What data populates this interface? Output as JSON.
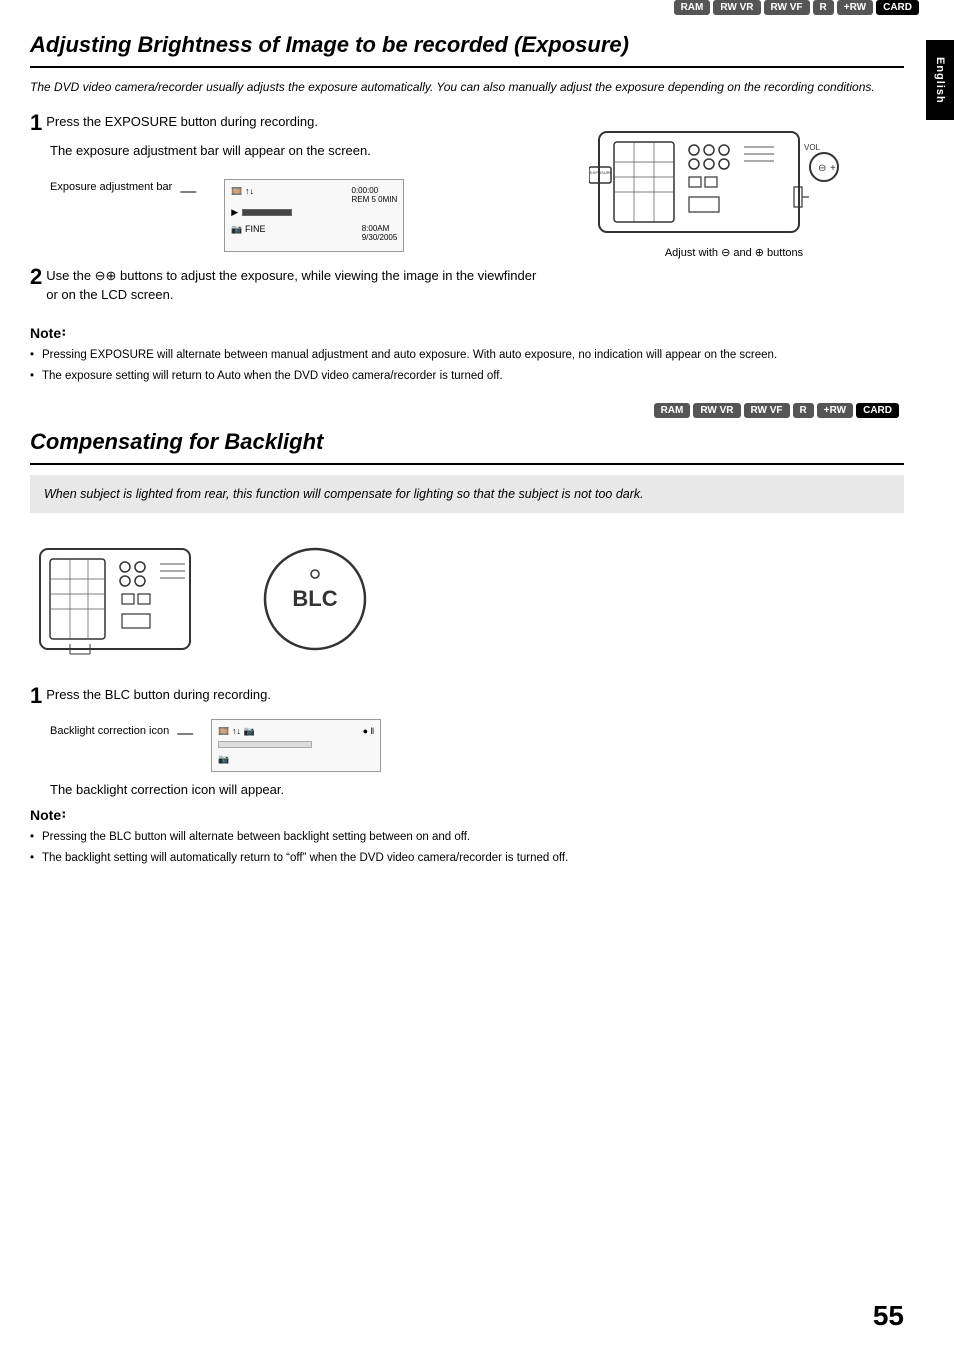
{
  "page": {
    "number": "55",
    "side_tab": "English"
  },
  "section1": {
    "badges": [
      "RAM",
      "RW VR",
      "RW VF",
      "R",
      "+RW",
      "CARD"
    ],
    "title": "Adjusting Brightness of Image to be recorded (Exposure)",
    "subtitle": "The DVD video camera/recorder usually adjusts the exposure automatically. You can also manually adjust the exposure depending on the recording conditions.",
    "step1_text": "Press the EXPOSURE button during recording.",
    "step1_indent": "The exposure adjustment bar will appear on the screen.",
    "exposure_bar_label": "Exposure adjustment bar",
    "step2_text": "Use the ⊖⊕ buttons to adjust the exposure, while viewing the image in the viewfinder or on the LCD screen.",
    "adjust_label": "Adjust with ⊖ and ⊕ buttons",
    "note_title": "Note",
    "notes": [
      "Pressing EXPOSURE will alternate between manual adjustment and auto exposure. With auto exposure, no indication will appear on the screen.",
      "The exposure setting will return to Auto when the DVD video camera/recorder is turned off."
    ]
  },
  "section2": {
    "badges": [
      "RAM",
      "RW VR",
      "RW VF",
      "R",
      "+RW",
      "CARD"
    ],
    "title": "Compensating for Backlight",
    "subtitle": "When subject is lighted from rear, this function will compensate for lighting so that the subject is not too dark.",
    "step1_text": "Press the BLC button during recording.",
    "backlight_label": "Backlight correction icon",
    "backlight_appear": "The backlight correction icon will appear.",
    "note_title": "Note",
    "notes": [
      "Pressing the BLC button will alternate between backlight setting between on and off.",
      "The backlight setting will automatically return to “off” when the DVD video camera/recorder is turned off."
    ]
  }
}
